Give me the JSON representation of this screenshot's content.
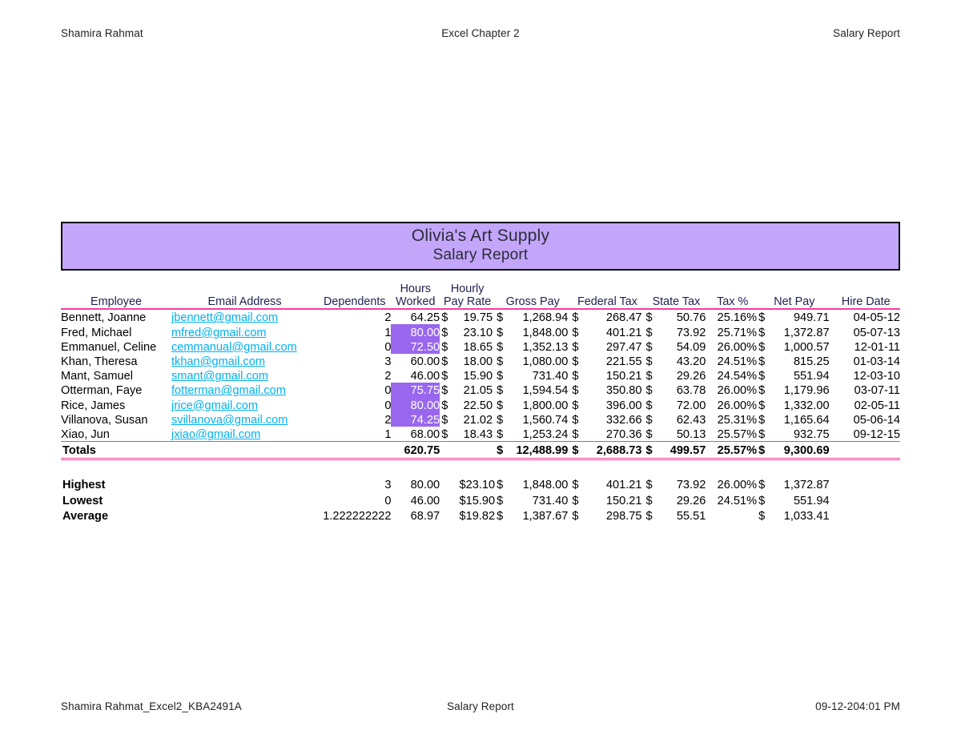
{
  "page_header": {
    "left": "Shamira Rahmat",
    "center": "Excel Chapter 2",
    "right": "Salary Report"
  },
  "page_footer": {
    "left": "Shamira Rahmat_Excel2_KBA2491A",
    "center": "Salary Report",
    "right": "09-12-204:01 PM"
  },
  "title": {
    "company": "Olivia's Art Supply",
    "report": "Salary Report"
  },
  "colors": {
    "title_fill": "#C3A6FA",
    "header_text": "#1F2050",
    "rule_pink": "#EF3F9E",
    "highlight_fill": "#9966EE",
    "highlight_text": "#FFFFFF",
    "hyperlink": "#00B0F0"
  },
  "columns": {
    "employee": "Employee",
    "email": "Email Address",
    "dependents": "Dependents",
    "hours_worked_line1": "Hours",
    "hours_worked_line2": "Worked",
    "hourly_rate_line1": "Hourly",
    "hourly_rate_line2": "Pay Rate",
    "gross_pay": "Gross Pay",
    "federal_tax": "Federal Tax",
    "state_tax": "State Tax",
    "tax_pct": "Tax %",
    "net_pay": "Net Pay",
    "hire_date": "Hire Date"
  },
  "rows": [
    {
      "employee": "Bennett, Joanne",
      "email": "jbennett@gmail.com",
      "dependents": "2",
      "hours": "64.25",
      "hours_highlighted": false,
      "rate_sym": "$",
      "rate": "19.75",
      "gross_sym": "$",
      "gross": "1,268.94",
      "fed_sym": "$",
      "fed": "268.47",
      "state_sym": "$",
      "state": "50.76",
      "tax_pct": "25.16%",
      "net_sym": "$",
      "net": "949.71",
      "hire_date": "04-05-12"
    },
    {
      "employee": "Fred, Michael",
      "email": "mfred@gmail.com",
      "dependents": "1",
      "hours": "80.00",
      "hours_highlighted": true,
      "rate_sym": "$",
      "rate": "23.10",
      "gross_sym": "$",
      "gross": "1,848.00",
      "fed_sym": "$",
      "fed": "401.21",
      "state_sym": "$",
      "state": "73.92",
      "tax_pct": "25.71%",
      "net_sym": "$",
      "net": "1,372.87",
      "hire_date": "05-07-13"
    },
    {
      "employee": "Emmanuel, Celine",
      "email": "cemmanual@gmail.com",
      "dependents": "0",
      "hours": "72.50",
      "hours_highlighted": true,
      "rate_sym": "$",
      "rate": "18.65",
      "gross_sym": "$",
      "gross": "1,352.13",
      "fed_sym": "$",
      "fed": "297.47",
      "state_sym": "$",
      "state": "54.09",
      "tax_pct": "26.00%",
      "net_sym": "$",
      "net": "1,000.57",
      "hire_date": "12-01-11"
    },
    {
      "employee": "Khan, Theresa",
      "email": "tkhan@gmail.com",
      "dependents": "3",
      "hours": "60.00",
      "hours_highlighted": false,
      "rate_sym": "$",
      "rate": "18.00",
      "gross_sym": "$",
      "gross": "1,080.00",
      "fed_sym": "$",
      "fed": "221.55",
      "state_sym": "$",
      "state": "43.20",
      "tax_pct": "24.51%",
      "net_sym": "$",
      "net": "815.25",
      "hire_date": "01-03-14"
    },
    {
      "employee": "Mant, Samuel",
      "email": "smant@gmail.com",
      "dependents": "2",
      "hours": "46.00",
      "hours_highlighted": false,
      "rate_sym": "$",
      "rate": "15.90",
      "gross_sym": "$",
      "gross": "731.40",
      "fed_sym": "$",
      "fed": "150.21",
      "state_sym": "$",
      "state": "29.26",
      "tax_pct": "24.54%",
      "net_sym": "$",
      "net": "551.94",
      "hire_date": "12-03-10"
    },
    {
      "employee": "Otterman, Faye",
      "email": "fotterman@gmail.com",
      "dependents": "0",
      "hours": "75.75",
      "hours_highlighted": true,
      "rate_sym": "$",
      "rate": "21.05",
      "gross_sym": "$",
      "gross": "1,594.54",
      "fed_sym": "$",
      "fed": "350.80",
      "state_sym": "$",
      "state": "63.78",
      "tax_pct": "26.00%",
      "net_sym": "$",
      "net": "1,179.96",
      "hire_date": "03-07-11"
    },
    {
      "employee": "Rice, James",
      "email": "jrice@gmail.com",
      "dependents": "0",
      "hours": "80.00",
      "hours_highlighted": true,
      "rate_sym": "$",
      "rate": "22.50",
      "gross_sym": "$",
      "gross": "1,800.00",
      "fed_sym": "$",
      "fed": "396.00",
      "state_sym": "$",
      "state": "72.00",
      "tax_pct": "26.00%",
      "net_sym": "$",
      "net": "1,332.00",
      "hire_date": "02-05-11"
    },
    {
      "employee": "Villanova, Susan",
      "email": "svillanova@gmail.com",
      "dependents": "2",
      "hours": "74.25",
      "hours_highlighted": true,
      "rate_sym": "$",
      "rate": "21.02",
      "gross_sym": "$",
      "gross": "1,560.74",
      "fed_sym": "$",
      "fed": "332.66",
      "state_sym": "$",
      "state": "62.43",
      "tax_pct": "25.31%",
      "net_sym": "$",
      "net": "1,165.64",
      "hire_date": "05-06-14"
    },
    {
      "employee": "Xiao, Jun",
      "email": "jxiao@gmail.com",
      "dependents": "1",
      "hours": "68.00",
      "hours_highlighted": false,
      "rate_sym": "$",
      "rate": "18.43",
      "gross_sym": "$",
      "gross": "1,253.24",
      "fed_sym": "$",
      "fed": "270.36",
      "state_sym": "$",
      "state": "50.13",
      "tax_pct": "25.57%",
      "net_sym": "$",
      "net": "932.75",
      "hire_date": "09-12-15"
    }
  ],
  "totals": {
    "label": "Totals",
    "email": "",
    "dependents": "",
    "hours": "620.75",
    "rate": "",
    "gross_sym": "$",
    "gross": "12,488.99",
    "fed_sym": "$",
    "fed": "2,688.73",
    "state_sym": "$",
    "state": "499.57",
    "tax_pct": "25.57%",
    "net_sym": "$",
    "net": "9,300.69",
    "hire_date": ""
  },
  "stats": [
    {
      "label": "Highest",
      "dependents": "3",
      "hours": "80.00",
      "rate": "$23.10",
      "gross_sym": "$",
      "gross": "1,848.00",
      "fed_sym": "$",
      "fed": "401.21",
      "state_sym": "$",
      "state": "73.92",
      "tax_pct": "26.00%",
      "net_sym": "$",
      "net": "1,372.87"
    },
    {
      "label": "Lowest",
      "dependents": "0",
      "hours": "46.00",
      "rate": "$15.90",
      "gross_sym": "$",
      "gross": "731.40",
      "fed_sym": "$",
      "fed": "150.21",
      "state_sym": "$",
      "state": "29.26",
      "tax_pct": "24.51%",
      "net_sym": "$",
      "net": "551.94"
    },
    {
      "label": "Average",
      "dependents": "1.222222222",
      "hours": "68.97",
      "rate": "$19.82",
      "gross_sym": "$",
      "gross": "1,387.67",
      "fed_sym": "$",
      "fed": "298.75",
      "state_sym": "$",
      "state": "55.51",
      "tax_pct": "",
      "net_sym": "$",
      "net": "1,033.41"
    }
  ]
}
